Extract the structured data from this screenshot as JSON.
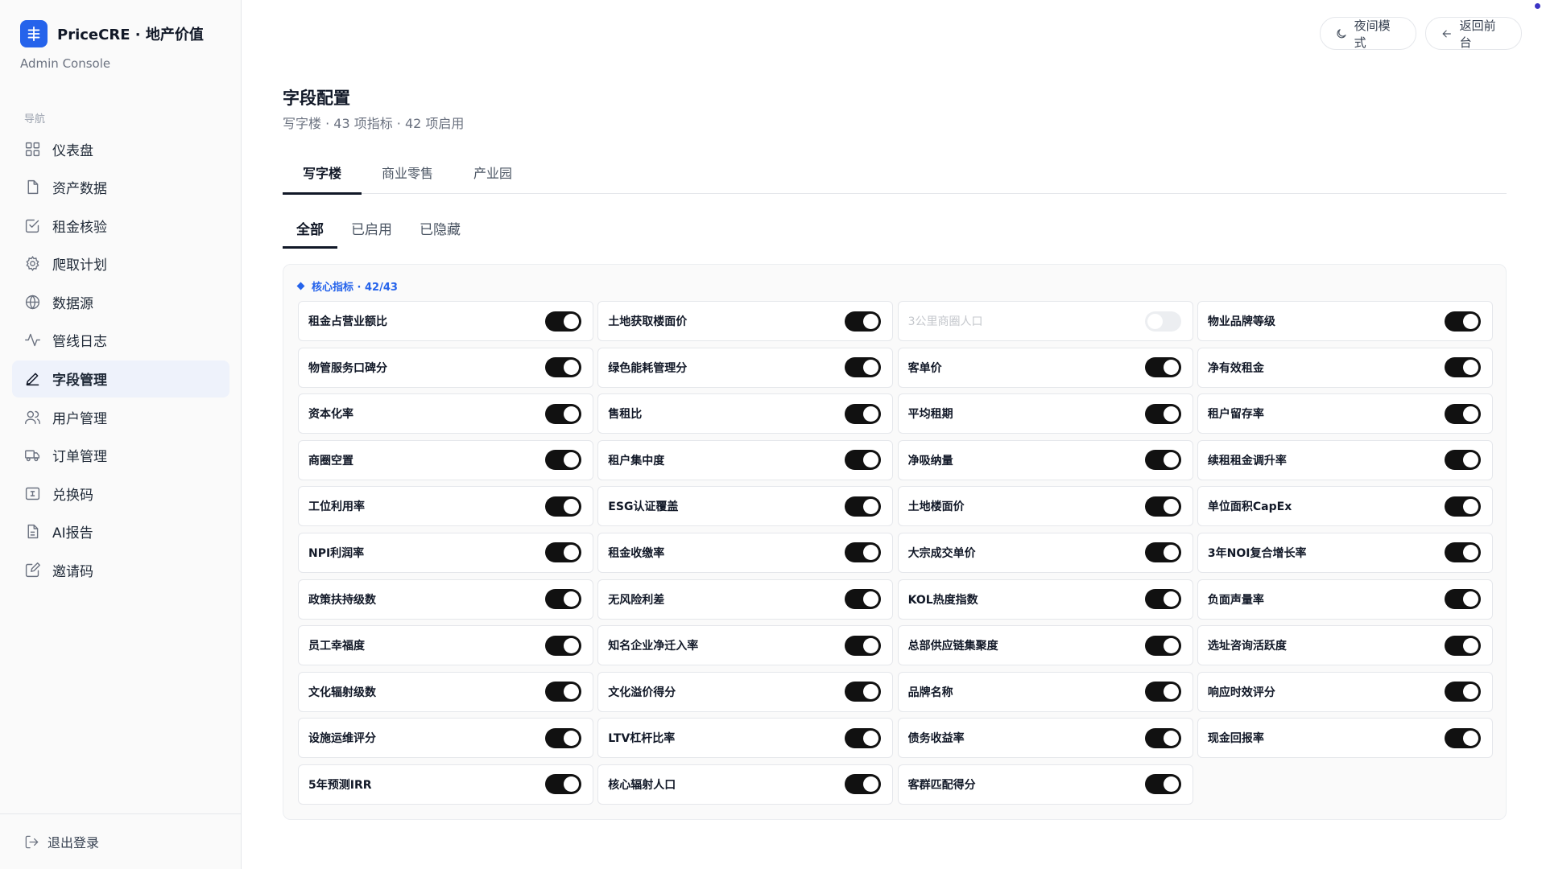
{
  "brand": {
    "title": "PriceCRE · 地产价值",
    "subtitle": "Admin Console"
  },
  "nav": {
    "section_label": "导航",
    "items": [
      {
        "label": "仪表盘",
        "icon": "grid-icon"
      },
      {
        "label": "资产数据",
        "icon": "file-icon"
      },
      {
        "label": "租金核验",
        "icon": "check-square-icon"
      },
      {
        "label": "爬取计划",
        "icon": "gear-icon"
      },
      {
        "label": "数据源",
        "icon": "globe-icon"
      },
      {
        "label": "管线日志",
        "icon": "activity-icon"
      },
      {
        "label": "字段管理",
        "icon": "pen-icon",
        "active": true
      },
      {
        "label": "用户管理",
        "icon": "users-icon"
      },
      {
        "label": "订单管理",
        "icon": "truck-icon"
      },
      {
        "label": "兑换码",
        "icon": "ticket-icon"
      },
      {
        "label": "AI报告",
        "icon": "report-icon"
      },
      {
        "label": "邀请码",
        "icon": "edit-square-icon"
      }
    ],
    "logout": "退出登录"
  },
  "topbar": {
    "night_mode": "夜间模式",
    "back": "返回前台"
  },
  "page": {
    "title": "字段配置",
    "subtitle": "写字楼 · 43 项指标 · 42 项启用"
  },
  "tabs": [
    {
      "label": "写字楼",
      "active": true
    },
    {
      "label": "商业零售"
    },
    {
      "label": "产业园"
    }
  ],
  "subtabs": [
    {
      "label": "全部",
      "active": true
    },
    {
      "label": "已启用"
    },
    {
      "label": "已隐藏"
    }
  ],
  "group": {
    "title": "核心指标 · 42/43",
    "fields": [
      {
        "label": "租金占营业额比",
        "enabled": true
      },
      {
        "label": "土地获取楼面价",
        "enabled": true
      },
      {
        "label": "3公里商圈人口",
        "enabled": false
      },
      {
        "label": "物业品牌等级",
        "enabled": true
      },
      {
        "label": "物管服务口碑分",
        "enabled": true
      },
      {
        "label": "绿色能耗管理分",
        "enabled": true
      },
      {
        "label": "客单价",
        "enabled": true
      },
      {
        "label": "净有效租金",
        "enabled": true
      },
      {
        "label": "资本化率",
        "enabled": true
      },
      {
        "label": "售租比",
        "enabled": true
      },
      {
        "label": "平均租期",
        "enabled": true
      },
      {
        "label": "租户留存率",
        "enabled": true
      },
      {
        "label": "商圈空置",
        "enabled": true
      },
      {
        "label": "租户集中度",
        "enabled": true
      },
      {
        "label": "净吸纳量",
        "enabled": true
      },
      {
        "label": "续租租金调升率",
        "enabled": true
      },
      {
        "label": "工位利用率",
        "enabled": true
      },
      {
        "label": "ESG认证覆盖",
        "enabled": true
      },
      {
        "label": "土地楼面价",
        "enabled": true
      },
      {
        "label": "单位面积CapEx",
        "enabled": true
      },
      {
        "label": "NPI利润率",
        "enabled": true
      },
      {
        "label": "租金收缴率",
        "enabled": true
      },
      {
        "label": "大宗成交单价",
        "enabled": true
      },
      {
        "label": "3年NOI复合增长率",
        "enabled": true
      },
      {
        "label": "政策扶持级数",
        "enabled": true
      },
      {
        "label": "无风险利差",
        "enabled": true
      },
      {
        "label": "KOL热度指数",
        "enabled": true
      },
      {
        "label": "负面声量率",
        "enabled": true
      },
      {
        "label": "员工幸福度",
        "enabled": true
      },
      {
        "label": "知名企业净迁入率",
        "enabled": true
      },
      {
        "label": "总部供应链集聚度",
        "enabled": true
      },
      {
        "label": "选址咨询活跃度",
        "enabled": true
      },
      {
        "label": "文化辐射级数",
        "enabled": true
      },
      {
        "label": "文化溢价得分",
        "enabled": true
      },
      {
        "label": "品牌名称",
        "enabled": true
      },
      {
        "label": "响应时效评分",
        "enabled": true
      },
      {
        "label": "设施运维评分",
        "enabled": true
      },
      {
        "label": "LTV杠杆比率",
        "enabled": true
      },
      {
        "label": "债务收益率",
        "enabled": true
      },
      {
        "label": "现金回报率",
        "enabled": true
      },
      {
        "label": "5年预测IRR",
        "enabled": true
      },
      {
        "label": "核心辐射人口",
        "enabled": true
      },
      {
        "label": "客群匹配得分",
        "enabled": true
      }
    ]
  },
  "colors": {
    "accent": "#2563eb",
    "toggle_on": "#111111",
    "toggle_off": "#eceef1"
  }
}
